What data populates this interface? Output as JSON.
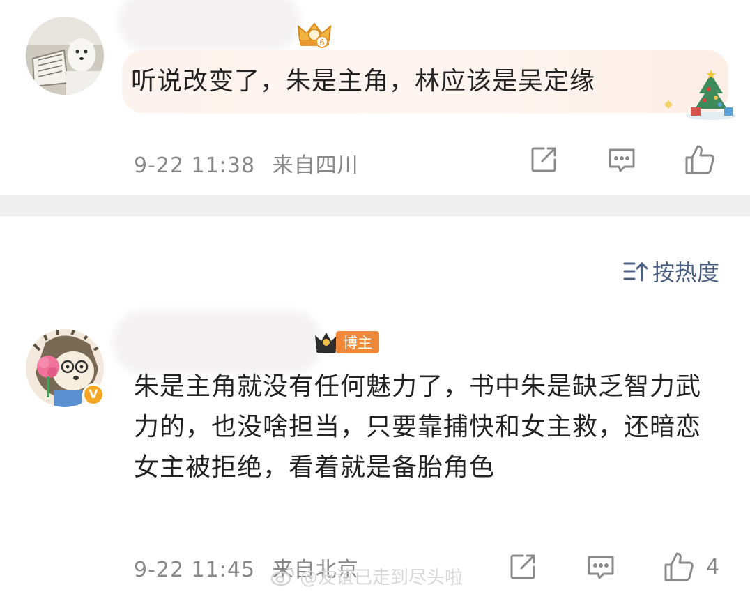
{
  "comments": [
    {
      "text": "听说改变了，朱是主角，林应该是吴定缘",
      "time": "9-22 11:38",
      "location": "来自四川",
      "badge_level": "6"
    },
    {
      "text": "朱是主角就没有任何魅力了，书中朱是缺乏智力武力的，也没啥担当，只要靠捕快和女主救，还暗恋女主被拒绝，看着就是备胎角色",
      "time": "9-22 11:45",
      "location": "来自北京",
      "badge_label": "博主",
      "verified_mark": "V",
      "likes": "4"
    }
  ],
  "sort": {
    "label": "按热度"
  },
  "watermark": {
    "text": "@友谊已走到尽头啦"
  },
  "icons": {
    "share": "share-icon",
    "comment": "comment-icon",
    "like": "thumbs-up-icon",
    "sort": "sort-icon",
    "crown": "crown-icon",
    "weibo": "weibo-icon"
  },
  "colors": {
    "accent": "#4a5e80",
    "meta": "#888888",
    "badge": "#f0883a",
    "verified": "#f6a623"
  }
}
